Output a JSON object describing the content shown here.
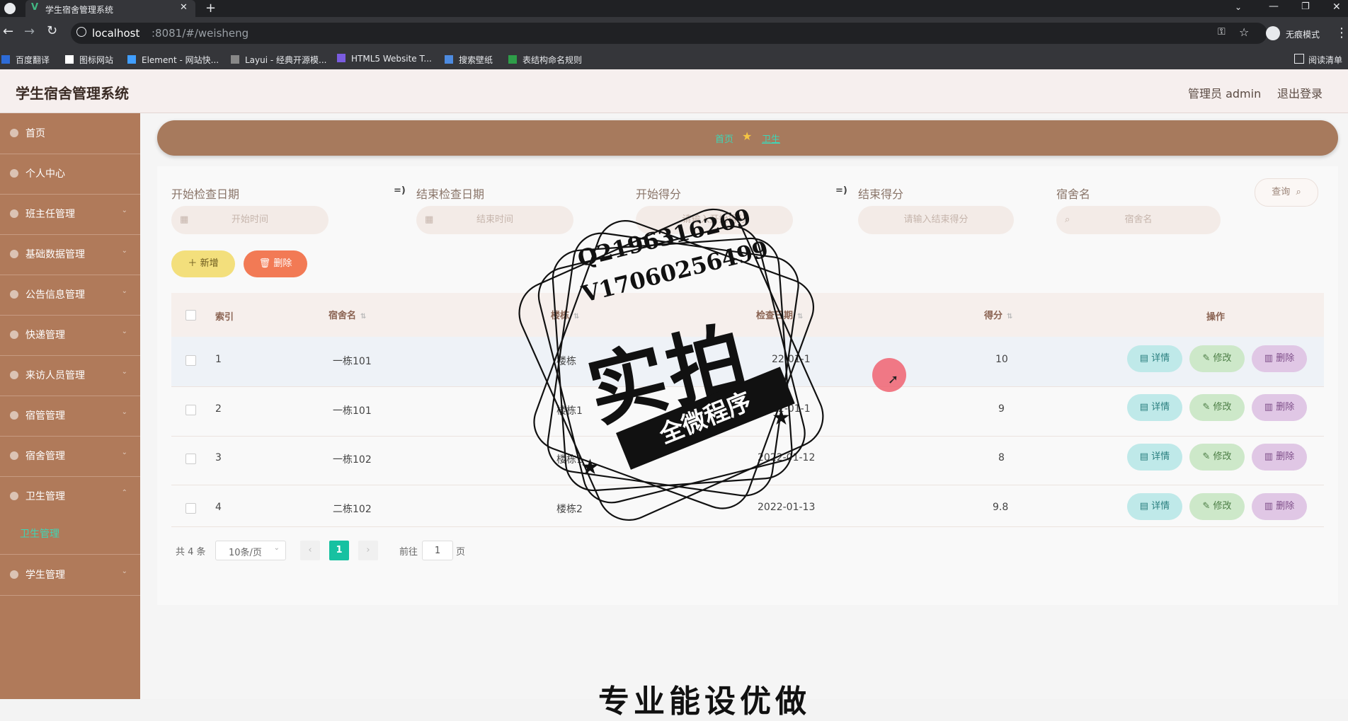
{
  "browser": {
    "tab_title": "学生宿舍管理系统",
    "new_tab": "+",
    "url_host": "localhost",
    "url_rest": ":8081/#/weisheng",
    "incognito": "无痕模式",
    "bookmarks": [
      "百度翻译",
      "图标网站",
      "Element - 网站快...",
      "Layui - 经典开源模...",
      "HTML5 Website T...",
      "搜索壁纸",
      "表结构命名规则"
    ],
    "reading_list": "阅读清单"
  },
  "header": {
    "title": "学生宿舍管理系统",
    "user": "管理员 admin",
    "logout": "退出登录"
  },
  "sidebar": {
    "items": [
      {
        "label": "首页"
      },
      {
        "label": "个人中心"
      },
      {
        "label": "班主任管理"
      },
      {
        "label": "基础数据管理"
      },
      {
        "label": "公告信息管理"
      },
      {
        "label": "快递管理"
      },
      {
        "label": "来访人员管理"
      },
      {
        "label": "宿管管理"
      },
      {
        "label": "宿舍管理"
      },
      {
        "label": "卫生管理"
      }
    ],
    "sub_item": "卫生管理",
    "last_item": "学生管理"
  },
  "breadcrumb": {
    "home": "首页",
    "current": "卫生"
  },
  "filters": {
    "start_date_label": "开始检查日期",
    "start_date_placeholder": "开始时间",
    "end_date_label": "结束检查日期",
    "end_date_placeholder": "结束时间",
    "start_score_label": "开始得分",
    "start_score_placeholder": "请输入开始得分",
    "end_score_label": "结束得分",
    "end_score_placeholder": "请输入结束得分",
    "dorm_label": "宿舍名",
    "dorm_placeholder": "宿舍名",
    "arrow": "=)",
    "search_btn": "查询"
  },
  "actions": {
    "add": "新增",
    "delete": "删除"
  },
  "table": {
    "headers": {
      "index": "索引",
      "dorm": "宿舍名",
      "building": "楼栋",
      "date": "检查日期",
      "score": "得分",
      "ops": "操作"
    },
    "rows": [
      {
        "index": "1",
        "dorm": "一栋101",
        "building": "楼栋",
        "date": "22-01-1",
        "score": "10"
      },
      {
        "index": "2",
        "dorm": "一栋101",
        "building": "楼栋1",
        "date": "22-01-1",
        "score": "9"
      },
      {
        "index": "3",
        "dorm": "一栋102",
        "building": "楼栋1",
        "date": "2022-01-12",
        "score": "8"
      },
      {
        "index": "4",
        "dorm": "二栋102",
        "building": "楼栋2",
        "date": "2022-01-13",
        "score": "9.8"
      }
    ],
    "op_detail": "详情",
    "op_edit": "修改",
    "op_delete": "删除"
  },
  "pager": {
    "total": "共 4 条",
    "page_size": "10条/页",
    "current": "1",
    "goto_prefix": "前往",
    "goto_value": "1",
    "goto_suffix": "页"
  },
  "watermark": {
    "line1": "Q2196316269",
    "line2": "V17060256499",
    "main": "实拍",
    "ribbon": "全微程序",
    "bottom": "专业能设优做"
  }
}
